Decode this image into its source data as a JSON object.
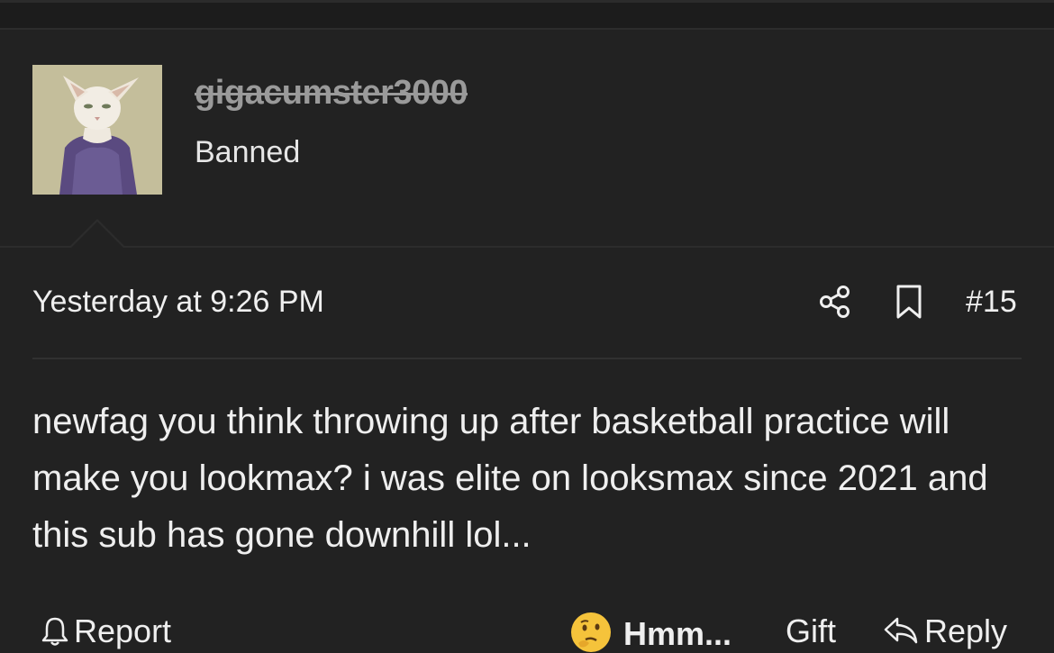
{
  "user": {
    "username": "gigacumster3000",
    "title": "Banned"
  },
  "post": {
    "timestamp": "Yesterday at 9:26 PM",
    "number": "#15",
    "body": "newfag you think throwing up after basketball practice will make you lookmax? i was elite on looksmax since 2021 and this sub has gone downhill lol..."
  },
  "actions": {
    "report_label": "Report",
    "reaction_label": "Hmm...",
    "gift_label": "Gift",
    "reply_label": "Reply"
  },
  "icons": {
    "share": "share-icon",
    "bookmark": "bookmark-icon",
    "report": "bell-icon",
    "reaction": "thinking-face-emoji",
    "reply": "reply-arrow-icon"
  },
  "colors": {
    "background": "#222222",
    "text": "#efefef",
    "banned_username": "#9a9a9a",
    "emoji": "#f5c33b"
  }
}
